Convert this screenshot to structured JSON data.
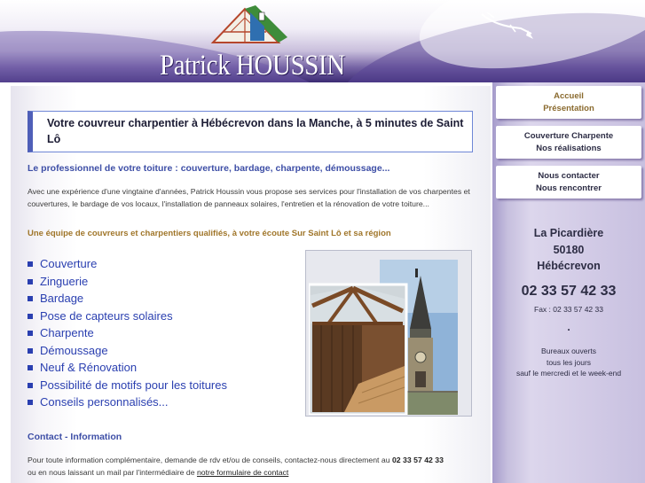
{
  "header": {
    "brand": "Patrick HOUSSIN",
    "logo_icon": "house-roof-logo-icon"
  },
  "main": {
    "title": "Votre couvreur charpentier à Hébécrevon dans la Manche, à 5 minutes de Saint Lô",
    "subtitle": "Le professionnel de votre toiture : couverture, bardage, charpente, démoussage...",
    "intro": "Avec une expérience d'une vingtaine d'années, Patrick Houssin vous propose ses services pour l'installation de vos charpentes et couvertures, le bardage de vos locaux, l'installation de panneaux solaires, l'entretien et la rénovation de votre toiture...",
    "team_line": "Une équipe de couvreurs et charpentiers qualifiés, à votre écoute Sur Saint Lô et sa région",
    "services": [
      " Couverture",
      "Zinguerie",
      "Bardage",
      "Pose de capteurs solaires",
      "Charpente",
      "Démoussage",
      "Neuf & Rénovation",
      "Possibilité de motifs pour les toitures",
      "Conseils personnalisés..."
    ],
    "photo_icon": "roof-work-photo",
    "contact_title": "Contact - Information",
    "contact_text_1": "Pour toute information complémentaire, demande de rdv et/ou de conseils, contactez-nous directement au ",
    "contact_phone": "02 33 57 42 33",
    "contact_text_2": "ou en nous laissant un mail par l'intermédiaire de ",
    "contact_link": "notre formulaire de contact"
  },
  "sidebar": {
    "nav": [
      {
        "line1": "Accueil",
        "line2": "Présentation"
      },
      {
        "line1": "Couverture Charpente",
        "line2": "Nos réalisations"
      },
      {
        "line1": "Nous contacter",
        "line2": "Nous rencontrer"
      }
    ],
    "address_line1": "La Picardière",
    "address_line2": "50180",
    "address_line3": "Hébécrevon",
    "phone": "02 33 57 42 33",
    "fax": "Fax : 02 33 57 42 33",
    "dot": ".",
    "hours_line1": "Bureaux ouverts",
    "hours_line2": "tous les jours",
    "hours_line3": "sauf le mercredi et le week-end"
  },
  "colors": {
    "accent_blue": "#2a3fb0",
    "header_purple": "#3c2b74",
    "gold": "#a0762a"
  }
}
